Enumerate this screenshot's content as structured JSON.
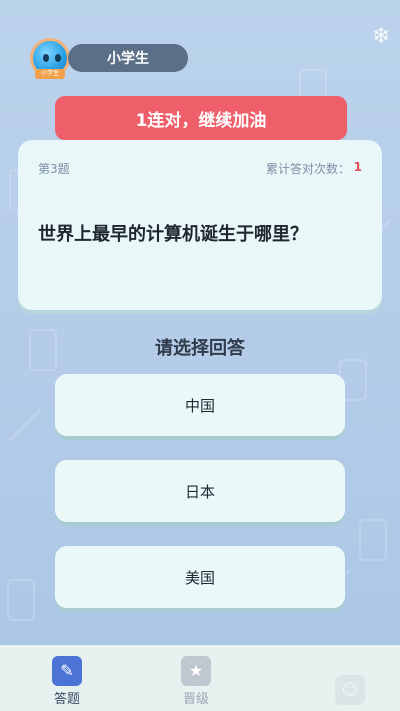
{
  "header": {
    "level_label": "小学生",
    "avatar_tag": "小学生"
  },
  "streak_banner": "1连对，继续加油",
  "question": {
    "number_label": "第3题",
    "count_label": "累计答对次数：",
    "count_value": "1",
    "text": "世界上最早的计算机诞生于哪里？"
  },
  "prompt": "请选择回答",
  "answers": [
    "中国",
    "日本",
    "美国"
  ],
  "tabs": [
    {
      "label": "答题",
      "icon": "pencil-icon"
    },
    {
      "label": "晋级",
      "icon": "trophy-icon"
    },
    {
      "label": "",
      "icon": "user-icon"
    }
  ],
  "colors": {
    "streak_bg": "#ef5f6a",
    "card_bg": "#e9f7f8",
    "tab_active": "#4b74d6"
  }
}
